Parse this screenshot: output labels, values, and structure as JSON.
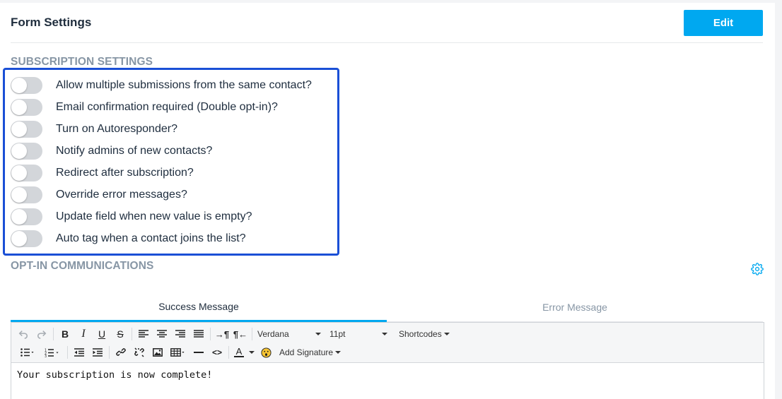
{
  "header": {
    "title": "Form Settings",
    "edit_label": "Edit"
  },
  "subscription": {
    "section_label": "SUBSCRIPTION SETTINGS",
    "toggles": [
      {
        "label": "Allow multiple submissions from the same contact?",
        "on": false
      },
      {
        "label": "Email confirmation required (Double opt-in)?",
        "on": false
      },
      {
        "label": "Turn on Autoresponder?",
        "on": false
      },
      {
        "label": "Notify admins of new contacts?",
        "on": false
      },
      {
        "label": "Redirect after subscription?",
        "on": false
      },
      {
        "label": "Override error messages?",
        "on": false
      },
      {
        "label": "Update field when new value is empty?",
        "on": false
      },
      {
        "label": "Auto tag when a contact joins the list?",
        "on": false
      }
    ]
  },
  "optin": {
    "section_label": "OPT-IN COMMUNICATIONS",
    "tabs": [
      {
        "label": "Success Message",
        "active": true
      },
      {
        "label": "Error Message",
        "active": false
      }
    ]
  },
  "editor": {
    "font_family": "Verdana",
    "font_size": "11pt",
    "shortcodes_label": "Shortcodes",
    "add_signature_label": "Add Signature",
    "color_letter": "A",
    "content": "Your subscription is now complete!"
  },
  "colors": {
    "accent": "#00a8f0",
    "highlight": "#1a4fd6",
    "toggle_off": "#d3d6da",
    "section": "#8796a5"
  }
}
